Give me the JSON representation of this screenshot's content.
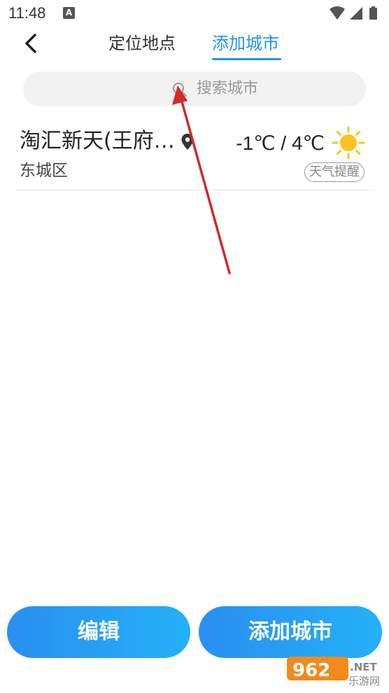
{
  "status_bar": {
    "time": "11:48",
    "notification_letter": "A"
  },
  "nav": {
    "tabs": [
      {
        "label": "定位地点",
        "active": false
      },
      {
        "label": "添加城市",
        "active": true
      }
    ]
  },
  "search": {
    "placeholder": "搜索城市"
  },
  "cities": [
    {
      "name": "淘汇新天(王府…",
      "district": "东城区",
      "temperature": "-1℃ / 4℃",
      "weather_icon": "sun-icon",
      "remind_label": "天气提醒"
    }
  ],
  "buttons": {
    "edit_label": "编辑",
    "add_label": "添加城市"
  },
  "watermark": {
    "brand": "962",
    "suffix": ".NET",
    "subtitle": "乐游网"
  },
  "colors": {
    "accent": "#1e95f0",
    "arrow": "#d42a2a",
    "sun": "#f7c51e"
  }
}
